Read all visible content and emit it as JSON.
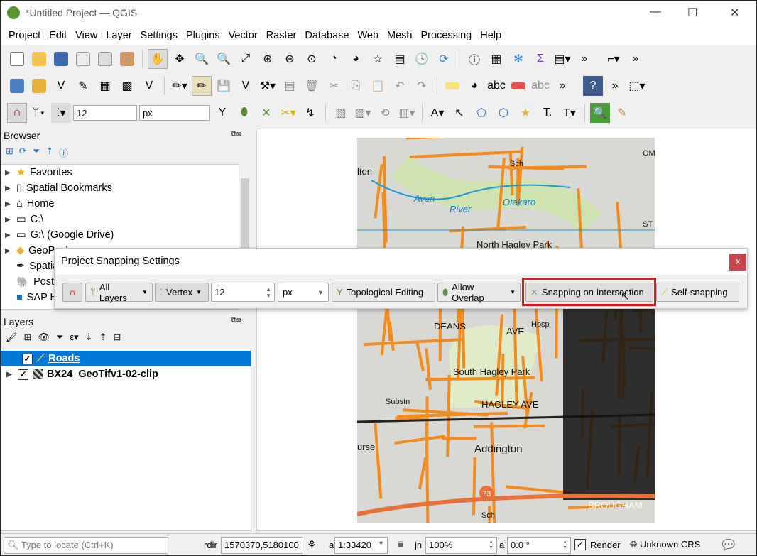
{
  "window": {
    "title": "*Untitled Project — QGIS",
    "minimize": "—",
    "maximize": "☐",
    "close": "✕"
  },
  "menu": [
    "Project",
    "Edit",
    "View",
    "Layer",
    "Settings",
    "Plugins",
    "Vector",
    "Raster",
    "Database",
    "Web",
    "Mesh",
    "Processing",
    "Help"
  ],
  "snapping_toolbar": {
    "tolerance": "12",
    "units": "px"
  },
  "browser": {
    "title": "Browser",
    "items": [
      {
        "label": "Favorites",
        "icon": "star-icon"
      },
      {
        "label": "Spatial Bookmarks",
        "icon": "bookmark-icon"
      },
      {
        "label": "Home",
        "icon": "home-icon"
      },
      {
        "label": "C:\\",
        "icon": "folder-icon"
      },
      {
        "label": "G:\\ (Google Drive)",
        "icon": "folder-icon"
      },
      {
        "label": "GeoPackage",
        "icon": "geopackage-icon"
      },
      {
        "label": "SpatiaLite",
        "icon": "spatialite-icon"
      },
      {
        "label": "PostGIS",
        "icon": "postgis-icon"
      },
      {
        "label": "SAP HANA",
        "icon": "sap-icon"
      }
    ]
  },
  "layers": {
    "title": "Layers",
    "items": [
      {
        "label": "Roads",
        "checked": true,
        "selected": true,
        "icon": "line-layer-icon"
      },
      {
        "label": "BX24_GeoTifv1-02-clip",
        "checked": true,
        "selected": false,
        "icon": "raster-layer-icon"
      }
    ]
  },
  "dialog": {
    "title": "Project Snapping Settings",
    "close": "x",
    "layers": "All Layers",
    "mode": "Vertex",
    "tolerance": "12",
    "units": "px",
    "topological": "Topological Editing",
    "overlap": "Allow Overlap",
    "intersection": "Snapping on Intersection",
    "self": "Self-snapping",
    "highlight_color": "#e8141a"
  },
  "map": {
    "labels": [
      "lton",
      "Sch",
      "Avon",
      "River",
      "Otakaro",
      "North Hagley Park",
      "DEANS",
      "AVE",
      "Hosp",
      "South Hagley Park",
      "HAGLEY AVE",
      "Substn",
      "Addington",
      "urse",
      "73",
      "Sch",
      "BROUGHAM",
      "OMBO",
      "ST"
    ],
    "road_color": "#f28c1e",
    "bg_color": "#d8d8d4"
  },
  "status": {
    "locate_placeholder": "Type to locate (Ctrl+K)",
    "coord_label": "rdir",
    "coordinate": "1570370,5180100",
    "scale_label": "a",
    "scale": "1:33420",
    "mag_label": "jn",
    "magnifier": "100%",
    "rot_label": "a",
    "rotation": "0.0 °",
    "render": "Render",
    "render_checked": true,
    "crs": "Unknown CRS"
  }
}
